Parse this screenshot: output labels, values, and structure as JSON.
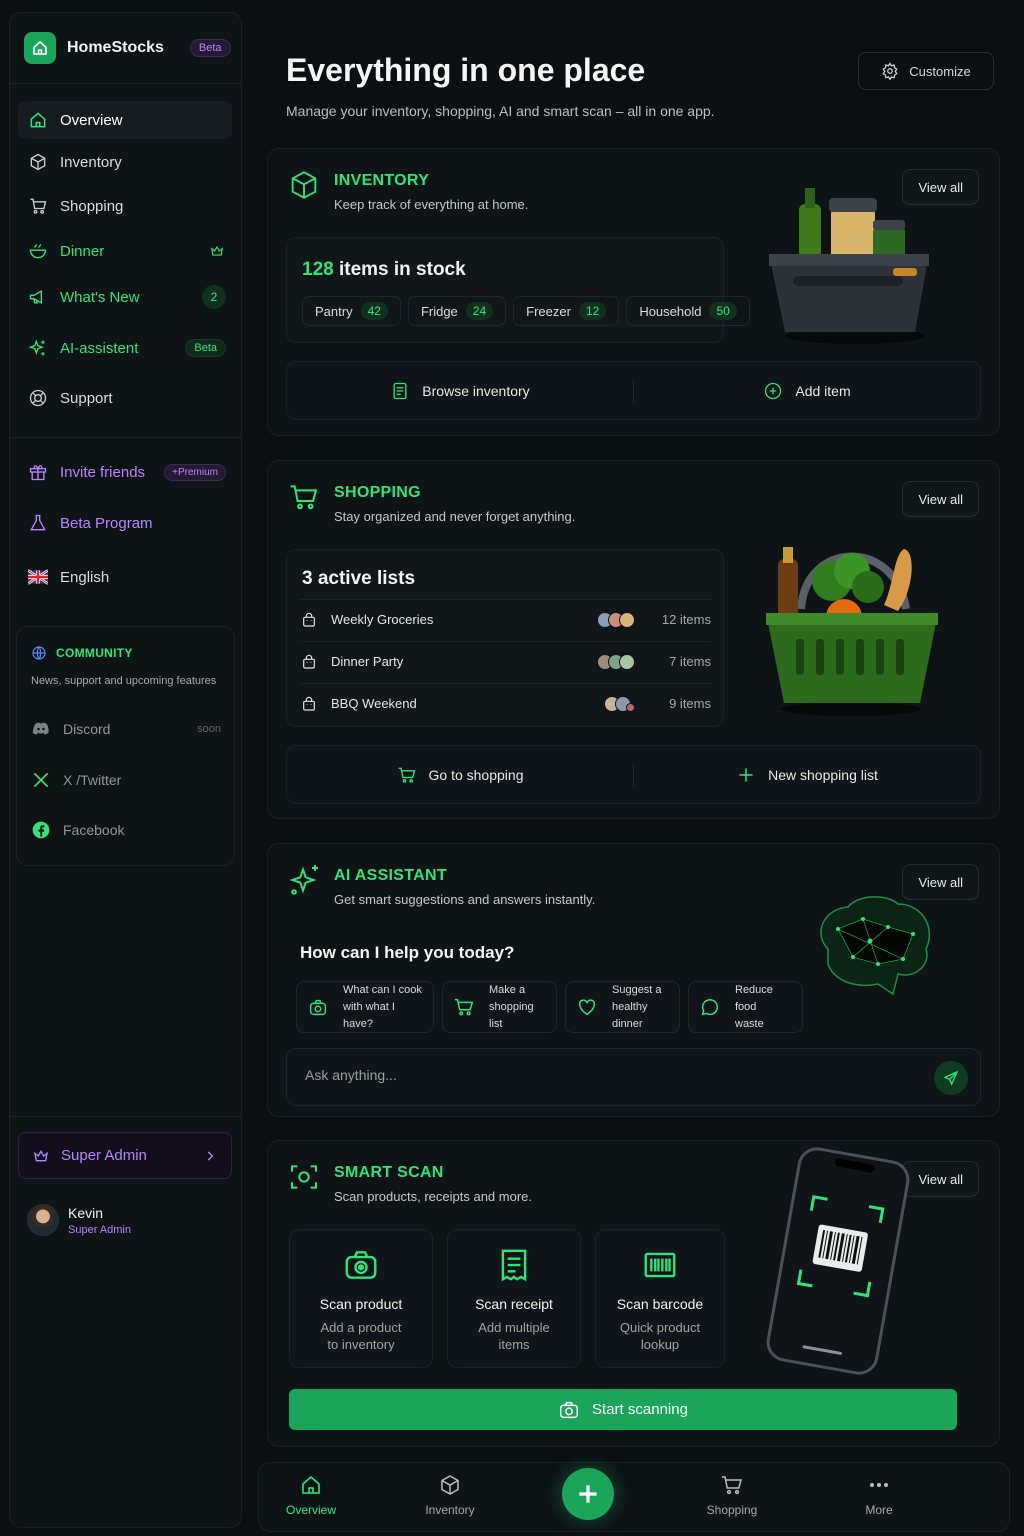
{
  "app": {
    "name": "HomeStocks",
    "badge": "Beta"
  },
  "sidebar": {
    "items": [
      {
        "label": "Overview",
        "icon": "home-icon"
      },
      {
        "label": "Inventory",
        "icon": "box-icon"
      },
      {
        "label": "Shopping",
        "icon": "cart-icon"
      },
      {
        "label": "Dinner",
        "icon": "bowl-icon"
      },
      {
        "label": "What's New",
        "icon": "megaphone-icon",
        "badge": "2"
      },
      {
        "label": "AI-assistent",
        "icon": "sparkle-icon",
        "badge": "Beta"
      },
      {
        "label": "Support",
        "icon": "lifebuoy-icon"
      }
    ],
    "invite": {
      "label": "Invite friends",
      "badge": "+Premium"
    },
    "beta_program": {
      "label": "Beta Program"
    },
    "language": {
      "label": "English"
    },
    "community": {
      "title": "COMMUNITY",
      "subtitle": "News, support and upcoming features",
      "items": [
        {
          "label": "Discord",
          "badge": "soon"
        },
        {
          "label": "X /Twitter"
        },
        {
          "label": "Facebook"
        }
      ]
    },
    "admin_button": "Super Admin",
    "user": {
      "name": "Kevin",
      "role": "Super Admin"
    }
  },
  "header": {
    "title": "Everything in one place",
    "subtitle": "Manage your inventory, shopping, AI and smart scan – all in one app.",
    "customize": "Customize"
  },
  "inventory": {
    "title": "INVENTORY",
    "subtitle": "Keep track of everything at home.",
    "view_all": "View all",
    "count": "128",
    "count_label": "items in stock",
    "chips": [
      {
        "label": "Pantry",
        "value": "42"
      },
      {
        "label": "Fridge",
        "value": "24"
      },
      {
        "label": "Freezer",
        "value": "12"
      },
      {
        "label": "Household",
        "value": "50"
      }
    ],
    "browse": "Browse inventory",
    "add": "Add item"
  },
  "shopping": {
    "title": "SHOPPING",
    "subtitle": "Stay organized and never forget anything.",
    "view_all": "View all",
    "heading": "3 active lists",
    "lists": [
      {
        "name": "Weekly Groceries",
        "count": "12 items"
      },
      {
        "name": "Dinner Party",
        "count": "7 items"
      },
      {
        "name": "BBQ Weekend",
        "count": "9 items"
      }
    ],
    "go": "Go to shopping",
    "new": "New shopping list"
  },
  "ai": {
    "title": "AI ASSISTANT",
    "subtitle": "Get smart suggestions and answers instantly.",
    "view_all": "View all",
    "heading": "How can I help you today?",
    "suggestions": [
      {
        "l1": "What can I cook",
        "l2": "with what I have?"
      },
      {
        "l1": "Make a",
        "l2": "shopping list"
      },
      {
        "l1": "Suggest a",
        "l2": "healthy dinner"
      },
      {
        "l1": "Reduce food",
        "l2": "waste"
      }
    ],
    "placeholder": "Ask anything..."
  },
  "scan": {
    "title": "SMART SCAN",
    "subtitle": "Scan products, receipts and more.",
    "view_all": "View all",
    "tiles": [
      {
        "title": "Scan product",
        "l1": "Add a product",
        "l2": "to inventory"
      },
      {
        "title": "Scan receipt",
        "l1": "Add multiple",
        "l2": "items"
      },
      {
        "title": "Scan barcode",
        "l1": "Quick product",
        "l2": "lookup"
      }
    ],
    "start": "Start scanning"
  },
  "bottom_nav": [
    {
      "label": "Overview"
    },
    {
      "label": "Inventory"
    },
    {
      "label": "Shopping"
    },
    {
      "label": "More"
    }
  ],
  "colors": {
    "accent": "#2ee57b",
    "button": "#1aa55a",
    "purple": "#b685ff",
    "bg": "#0b0f12"
  }
}
